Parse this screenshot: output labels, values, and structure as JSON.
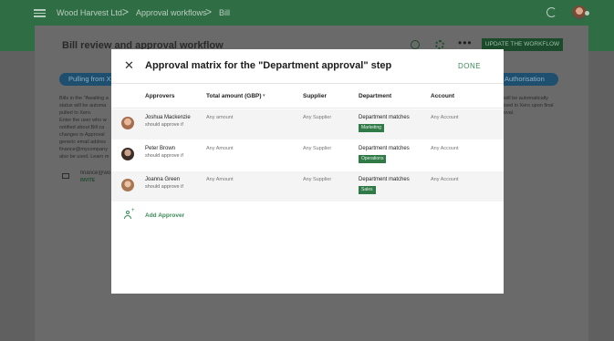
{
  "topbar": {
    "breadcrumbs": [
      "Wood Harvest Ltd.",
      "Approval workflows",
      "Bill"
    ],
    "separator": ">"
  },
  "page": {
    "title": "Bill review and approval workflow",
    "more_label": "•••",
    "update_button": "UPDATE THE WORKFLOW",
    "pill_left": "Pulling from Xero",
    "pill_right": "Authorisation",
    "left_text": [
      "Bills in the \"Awaiting a",
      "status will be automa",
      "pulled to Xero.",
      "",
      "Enter the user who w",
      "notified about Bill ca",
      "changes in Approval",
      "generic email addres",
      "finance@mycompany",
      "also be used. Learn m"
    ],
    "right_text": [
      "will be automatically",
      "ised in Xero upon final",
      "oval."
    ],
    "finance_email": "finance@wo",
    "invite_label": "INVITE"
  },
  "modal": {
    "close_label": "✕",
    "title": "Approval matrix for the \"Department approval\" step",
    "done_label": "DONE",
    "columns": {
      "approvers": "Approvers",
      "total": "Total amount (GBP)",
      "sort_icon": "▾",
      "supplier": "Supplier",
      "department": "Department",
      "account": "Account"
    },
    "rows": [
      {
        "name": "Joshua Mackenzie",
        "sub": "should approve if",
        "amount": "Any amount",
        "supplier": "Any Supplier",
        "department": "Department matches",
        "tag": "Marketing",
        "account": "Any Account",
        "avatar_color": "#c98b6b"
      },
      {
        "name": "Peter Brown",
        "sub": "should approve if",
        "amount": "Any Amount",
        "supplier": "Any Supplier",
        "department": "Department matches",
        "tag": "Operations",
        "account": "Any Account",
        "avatar_color": "#4a3a34"
      },
      {
        "name": "Joanna Green",
        "sub": "should approve if",
        "amount": "Any Amount",
        "supplier": "Any Supplier",
        "department": "Department matches",
        "tag": "Sales",
        "account": "Any Account",
        "avatar_color": "#b88a62"
      }
    ],
    "add_approver": "Add Approver"
  },
  "icons": {
    "menu": "hamburger-icon",
    "refresh": "refresh-icon",
    "help": "help-icon",
    "settings": "gear-icon",
    "mail": "mail-icon",
    "add_user": "add-user-icon"
  },
  "colors": {
    "brand_green": "#2f6e45",
    "accent_green": "#3d8a58",
    "tag_green": "#2f7a47"
  }
}
